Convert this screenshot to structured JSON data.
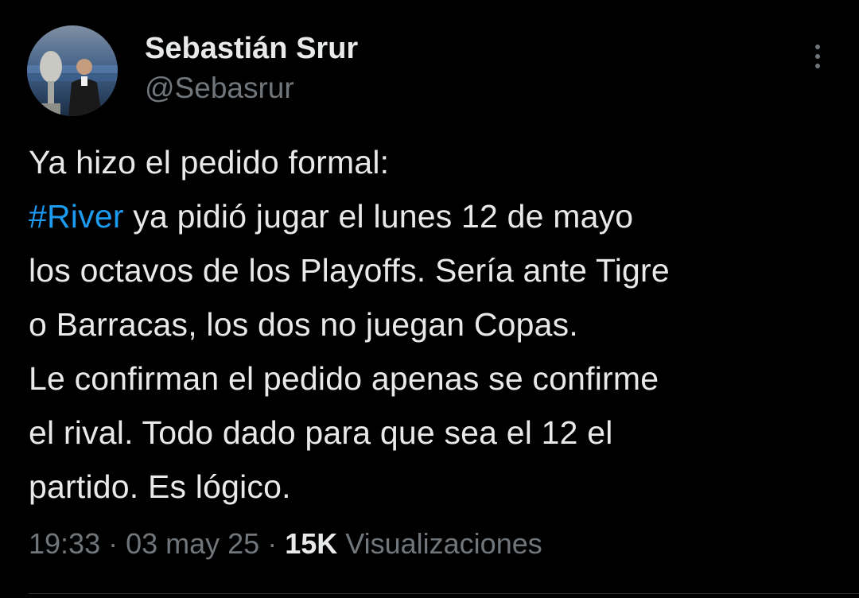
{
  "author": {
    "display_name": "Sebastián Srur",
    "handle": "@Sebasrur"
  },
  "tweet": {
    "line1": "Ya hizo el pedido formal:",
    "hashtag": "#River",
    "text_after_hashtag": " ya pidió jugar el lunes 12 de mayo\nlos octavos de los Playoffs. Sería ante Tigre\no Barracas, los dos no juegan Copas.\nLe confirman el pedido apenas se confirme\nel rival. Todo dado para que sea el 12 el\npartido. Es lógico."
  },
  "meta": {
    "time": "19:33",
    "separator": " · ",
    "date": "03 may 25",
    "views_count": "15K",
    "views_label": " Visualizaciones"
  },
  "colors": {
    "background": "#000000",
    "text": "#e7e9ea",
    "secondary": "#71767b",
    "link": "#1d9bf0"
  },
  "icons": {
    "more": "more-vertical-icon"
  }
}
